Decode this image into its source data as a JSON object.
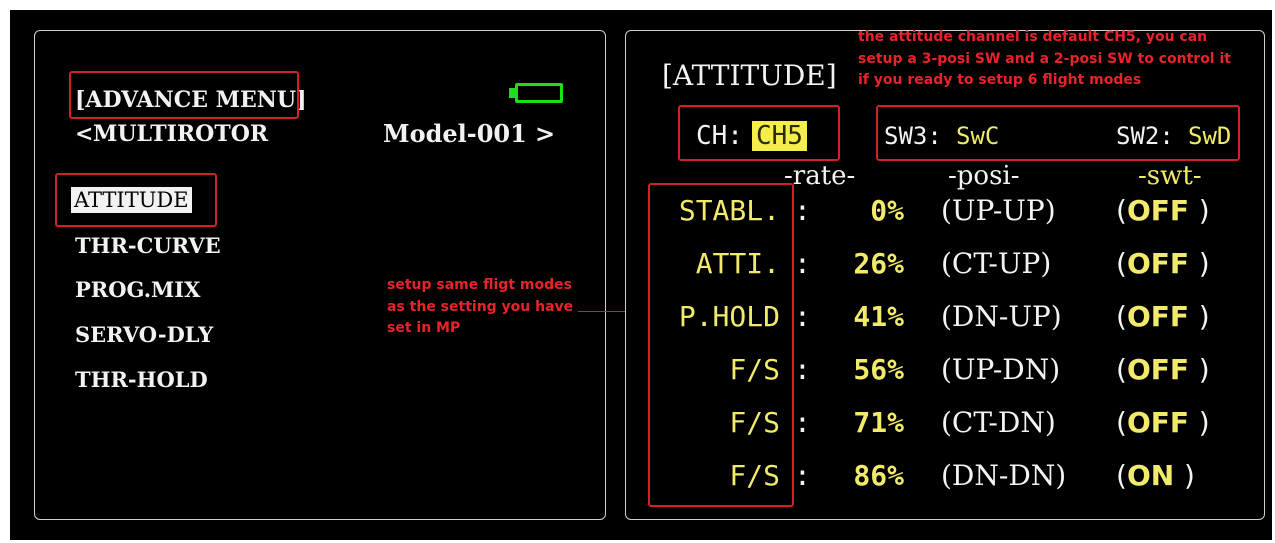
{
  "left_screen": {
    "title": "[ADVANCE MENU]",
    "nav_prev": "<",
    "category": "MULTIROTOR",
    "model": "Model-001",
    "nav_next": ">",
    "menu_items": [
      {
        "label": "ATTITUDE"
      },
      {
        "label": "THR-CURVE"
      },
      {
        "label": "PROG.MIX"
      },
      {
        "label": "SERVO-DLY"
      },
      {
        "label": "THR-HOLD"
      }
    ],
    "battery_color": "#19e019"
  },
  "right_screen": {
    "title": "[ATTITUDE]",
    "ch_label": "CH:",
    "ch_value": "CH5",
    "sw3_label": "SW3:",
    "sw3_value": "SwC",
    "sw2_label": "SW2:",
    "sw2_value": "SwD",
    "headers": {
      "rate": "-rate-",
      "posi": "-posi-",
      "swt": "-swt-"
    },
    "colon": ":",
    "paren_open": "(",
    "paren_close": ")",
    "rows": [
      {
        "mode": "STABL.",
        "rate": "0%",
        "posi": "(UP-UP)",
        "swt": "OFF"
      },
      {
        "mode": "ATTI.",
        "rate": "26%",
        "posi": "(CT-UP)",
        "swt": "OFF"
      },
      {
        "mode": "P.HOLD",
        "rate": "41%",
        "posi": "(DN-UP)",
        "swt": "OFF"
      },
      {
        "mode": "F/S",
        "rate": "56%",
        "posi": "(UP-DN)",
        "swt": "OFF"
      },
      {
        "mode": "F/S",
        "rate": "71%",
        "posi": "(CT-DN)",
        "swt": "OFF"
      },
      {
        "mode": "F/S",
        "rate": "86%",
        "posi": "(DN-DN)",
        "swt": "ON"
      }
    ],
    "highlight_color": "#f5ee4a",
    "text_yellow": "#f1ea6a"
  },
  "annotations": {
    "attitude_note_lines": [
      "the attitude channel is default CH5, you can",
      "setup a 3-posi SW and a 2-posi SW to control it",
      "if you ready to setup 6 flight modes"
    ],
    "modes_note_lines": [
      "setup same fligt modes",
      "as the setting you have",
      "set in MP"
    ],
    "annotation_color": "#e8232a"
  }
}
